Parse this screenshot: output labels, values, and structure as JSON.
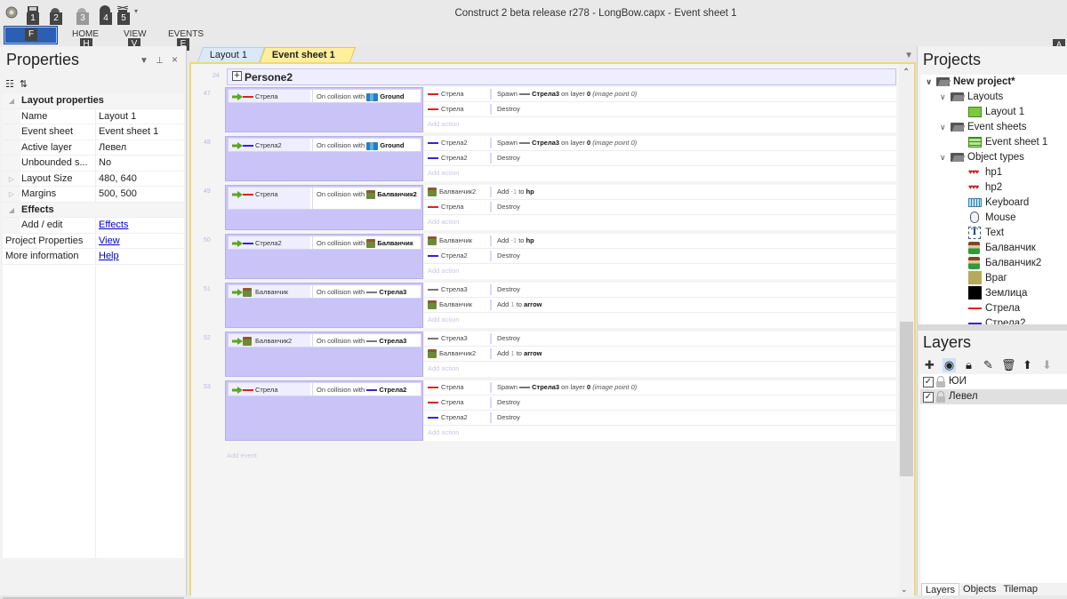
{
  "window": {
    "title": "Construct 2 beta release r278 - LongBow.capx - Event sheet 1"
  },
  "quick_access": [
    {
      "icon": "save-icon",
      "keytip": "1"
    },
    {
      "icon": "undo-icon",
      "keytip": "2"
    },
    {
      "icon": "redo-icon",
      "keytip": "3"
    },
    {
      "icon": "preview-icon",
      "keytip": "4"
    },
    {
      "icon": "debug-icon",
      "keytip": "5"
    }
  ],
  "ribbon": {
    "file_keytip": "F",
    "tabs": [
      {
        "label": "HOME",
        "keytip": "H"
      },
      {
        "label": "VIEW",
        "keytip": "V"
      },
      {
        "label": "EVENTS",
        "keytip": "E"
      }
    ],
    "help_keytip": "A"
  },
  "properties": {
    "title": "Properties",
    "categories": [
      {
        "label": "Layout properties"
      },
      {
        "label": "Effects"
      }
    ],
    "rows": [
      {
        "name": "Name",
        "value": "Layout 1"
      },
      {
        "name": "Event sheet",
        "value": "Event sheet 1"
      },
      {
        "name": "Active layer",
        "value": "Левел"
      },
      {
        "name": "Unbounded s...",
        "value": "No"
      },
      {
        "name": "Layout Size",
        "value": "480, 640"
      },
      {
        "name": "Margins",
        "value": "500, 500"
      },
      {
        "name": "Add / edit",
        "value": "Effects"
      },
      {
        "name": "Project Properties",
        "value": "View"
      },
      {
        "name": "More information",
        "value": "Help"
      }
    ]
  },
  "doc_tabs": [
    {
      "label": "Layout 1",
      "active": false
    },
    {
      "label": "Event sheet 1",
      "active": true
    }
  ],
  "event_sheet": {
    "group": {
      "line": "24",
      "name": "Persone2"
    },
    "add_action_label": "Add action",
    "add_event_label": "Add event",
    "events": [
      {
        "line": "47",
        "cond_object": "Стрела",
        "cond_icon": "red-line",
        "cond_text": "On collision with",
        "cond_target": "Ground",
        "target_icon": "ground",
        "actions": [
          {
            "object": "Стрела",
            "icon": "red-line",
            "text": "Spawn",
            "param_obj": "Стрела3",
            "rest": "on layer",
            "layer": "0",
            "note": "(image point 0)"
          },
          {
            "object": "Стрела",
            "icon": "red-line",
            "text": "Destroy"
          }
        ]
      },
      {
        "line": "48",
        "cond_object": "Стрела2",
        "cond_icon": "blue-line",
        "cond_text": "On collision with",
        "cond_target": "Ground",
        "target_icon": "ground",
        "actions": [
          {
            "object": "Стрела2",
            "icon": "blue-line",
            "text": "Spawn",
            "param_obj": "Стрела3",
            "rest": "on layer",
            "layer": "0",
            "note": "(image point 0)"
          },
          {
            "object": "Стрела2",
            "icon": "blue-line",
            "text": "Destroy"
          }
        ]
      },
      {
        "line": "49",
        "cond_object": "Стрела",
        "cond_icon": "red-line",
        "cond_text": "On collision with",
        "cond_target": "Балванчик2",
        "target_icon": "sprite",
        "actions": [
          {
            "object": "Балванчик2",
            "icon": "sprite",
            "text": "Add",
            "value": "-1",
            "to": "to",
            "var": "hp"
          },
          {
            "object": "Стрела",
            "icon": "red-line",
            "text": "Destroy"
          }
        ]
      },
      {
        "line": "50",
        "cond_object": "Стрела2",
        "cond_icon": "blue-line",
        "cond_text": "On collision with",
        "cond_target": "Балванчик",
        "target_icon": "sprite",
        "actions": [
          {
            "object": "Балванчик",
            "icon": "sprite",
            "text": "Add",
            "value": "-1",
            "to": "to",
            "var": "hp"
          },
          {
            "object": "Стрела2",
            "icon": "blue-line",
            "text": "Destroy"
          }
        ]
      },
      {
        "line": "51",
        "cond_object": "Балванчик",
        "cond_icon": "sprite",
        "cond_text": "On collision with",
        "cond_target": "Стрела3",
        "target_icon": "gray-line",
        "actions": [
          {
            "object": "Стрела3",
            "icon": "gray-line",
            "text": "Destroy"
          },
          {
            "object": "Балванчик",
            "icon": "sprite",
            "text": "Add",
            "value": "1",
            "to": "to",
            "var": "arrow"
          }
        ]
      },
      {
        "line": "52",
        "cond_object": "Балванчик2",
        "cond_icon": "sprite",
        "cond_text": "On collision with",
        "cond_target": "Стрела3",
        "target_icon": "gray-line",
        "actions": [
          {
            "object": "Стрела3",
            "icon": "gray-line",
            "text": "Destroy"
          },
          {
            "object": "Балванчик2",
            "icon": "sprite",
            "text": "Add",
            "value": "1",
            "to": "to",
            "var": "arrow"
          }
        ]
      },
      {
        "line": "53",
        "cond_object": "Стрела",
        "cond_icon": "red-line",
        "cond_text": "On collision with",
        "cond_target": "Стрела2",
        "target_icon": "blue-line",
        "actions": [
          {
            "object": "Стрела",
            "icon": "red-line",
            "text": "Spawn",
            "param_obj": "Стрела3",
            "rest": "on layer",
            "layer": "0",
            "note": "(image point 0)"
          },
          {
            "object": "Стрела",
            "icon": "red-line",
            "text": "Destroy"
          },
          {
            "object": "Стрела2",
            "icon": "blue-line",
            "text": "Destroy"
          }
        ]
      }
    ]
  },
  "projects": {
    "title": "Projects",
    "root": "New project*",
    "folders": {
      "layouts": "Layouts",
      "event_sheets": "Event sheets",
      "object_types": "Object types"
    },
    "layout": "Layout 1",
    "event_sheet": "Event sheet 1",
    "objects": [
      {
        "name": "hp1",
        "icon": "hp"
      },
      {
        "name": "hp2",
        "icon": "hp"
      },
      {
        "name": "Keyboard",
        "icon": "keyboard"
      },
      {
        "name": "Mouse",
        "icon": "mouse"
      },
      {
        "name": "Text",
        "icon": "text"
      },
      {
        "name": "Балванчик",
        "icon": "sprite"
      },
      {
        "name": "Балванчик2",
        "icon": "sprite"
      },
      {
        "name": "Враг",
        "icon": "swatch",
        "color": "#b5a95a"
      },
      {
        "name": "Землица",
        "icon": "swatch",
        "color": "#000000"
      },
      {
        "name": "Стрела",
        "icon": "line",
        "color": "#e02020"
      },
      {
        "name": "Стрела2",
        "icon": "line",
        "color": "#3a1ee0"
      }
    ]
  },
  "layers": {
    "title": "Layers",
    "items": [
      {
        "name": "ЮИ",
        "visible": true,
        "selected": false
      },
      {
        "name": "Левел",
        "visible": true,
        "selected": true
      }
    ]
  },
  "bottom_tabs": [
    "Layers",
    "Objects",
    "Tilemap"
  ]
}
